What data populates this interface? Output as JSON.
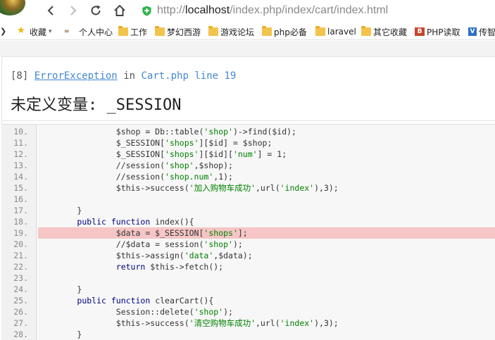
{
  "browser": {
    "url_prefix": "http://",
    "url_host": "localhost",
    "url_path": "/index.php/index/cart/index.html"
  },
  "bookmarks": [
    {
      "label": "收藏",
      "icon": "star-icon"
    },
    {
      "label": "个人中心",
      "icon": "logo-icon"
    },
    {
      "label": "工作",
      "icon": "folder-icon"
    },
    {
      "label": "梦幻西游",
      "icon": "folder-icon"
    },
    {
      "label": "游戏论坛",
      "icon": "folder-icon"
    },
    {
      "label": "php必备",
      "icon": "folder-icon"
    },
    {
      "label": "laravel",
      "icon": "folder-icon"
    },
    {
      "label": "其它收藏",
      "icon": "folder-icon"
    },
    {
      "label": "PHP读取",
      "icon": "site-icon"
    },
    {
      "label": "传智",
      "icon": "site-icon"
    }
  ],
  "error": {
    "code": "[8]",
    "class": "ErrorException",
    "in": "in",
    "file": "Cart.php line 19",
    "message": "未定义变量: _SESSION"
  },
  "code": {
    "highlight_line": "19.",
    "lines": [
      {
        "num": "10.",
        "text": "                $shop = Db::table('shop')->find($id);"
      },
      {
        "num": "11.",
        "text": "                $_SESSION['shops'][$id] = $shop;"
      },
      {
        "num": "12.",
        "text": "                $_SESSION['shops'][$id]['num'] = 1;"
      },
      {
        "num": "13.",
        "text": "                //session('shop',$shop);"
      },
      {
        "num": "14.",
        "text": "                //session('shop.num',1);"
      },
      {
        "num": "15.",
        "text": "                $this->success('加入购物车成功',url('index'),3);"
      },
      {
        "num": "16.",
        "text": ""
      },
      {
        "num": "17.",
        "text": "        }"
      },
      {
        "num": "18.",
        "text": "        public function index(){"
      },
      {
        "num": "19.",
        "text": "                $data = $_SESSION['shops'];"
      },
      {
        "num": "20.",
        "text": "                //$data = session('shop');"
      },
      {
        "num": "21.",
        "text": "                $this->assign('data',$data);"
      },
      {
        "num": "22.",
        "text": "                return $this->fetch();"
      },
      {
        "num": "23.",
        "text": ""
      },
      {
        "num": "24.",
        "text": "        }"
      },
      {
        "num": "25.",
        "text": "        public function clearCart(){"
      },
      {
        "num": "26.",
        "text": "                Session::delete('shop');"
      },
      {
        "num": "27.",
        "text": "                $this->success('清空购物车成功',url('index'),3);"
      },
      {
        "num": "28.",
        "text": "        }"
      }
    ]
  }
}
